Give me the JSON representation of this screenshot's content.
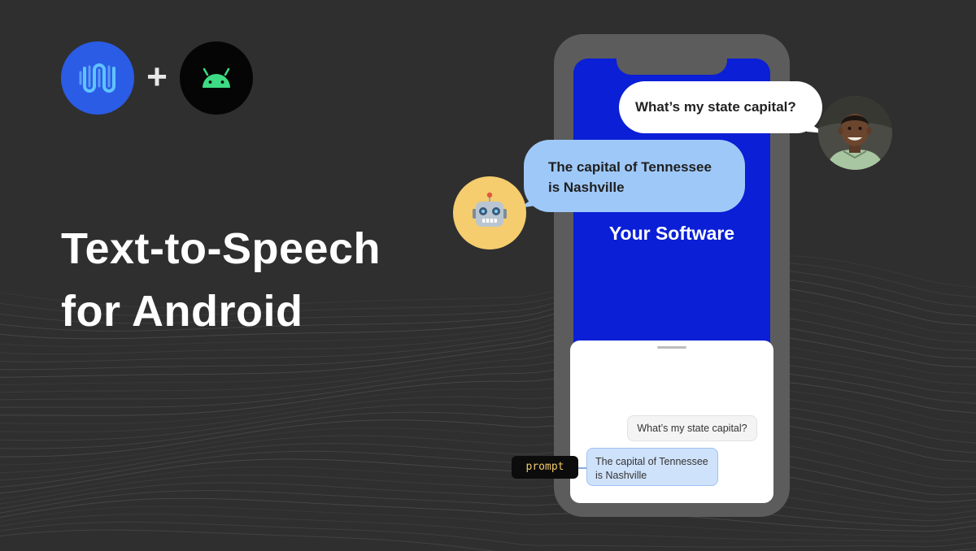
{
  "logos": {
    "primary": {
      "icon": "wave-logo-icon",
      "color": "#2b5ce6"
    },
    "separator": "+",
    "android": {
      "icon": "android-icon",
      "color": "#050505",
      "accent": "#3ddc84"
    }
  },
  "headline": {
    "line1": "Text-to-Speech",
    "line2": "for Android"
  },
  "phone": {
    "app_label": "Your Software",
    "screen_color": "#0a1fd6",
    "chat": {
      "user_message": "What’s my state capital?",
      "ai_message": "The capital of Tennessee is Nashville"
    },
    "prompt_tag": "prompt"
  },
  "floating_bubbles": {
    "user": "What’s my state capital?",
    "ai_line1": "The capital of Tennessee",
    "ai_line2": "is Nashville"
  },
  "avatars": {
    "robot": {
      "icon": "robot-face-icon",
      "color": "#f5cd6e"
    },
    "person": {
      "icon": "child-avatar-icon"
    }
  }
}
